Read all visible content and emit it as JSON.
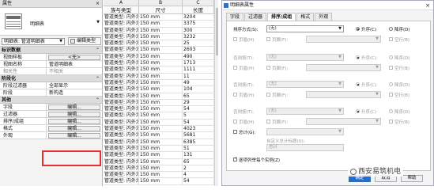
{
  "props": {
    "title": "属性",
    "close": "×",
    "type_name": "明细表",
    "selector": "明细表: 管道明细表",
    "edit_type": "编辑类型",
    "groups": [
      {
        "label": "标识数据",
        "rows": [
          {
            "k": "视图样板",
            "v": "<无>",
            "btn": true
          },
          {
            "k": "视图名称",
            "v": "管道明细表"
          },
          {
            "k": "相关性",
            "v": "不相关",
            "gray": true
          }
        ]
      },
      {
        "label": "阶段化",
        "rows": [
          {
            "k": "阶段过滤器",
            "v": "全部显示"
          },
          {
            "k": "阶段",
            "v": "新构造"
          }
        ]
      },
      {
        "label": "其他",
        "rows": [
          {
            "k": "字段",
            "v": "编辑...",
            "btn": true
          },
          {
            "k": "过滤器",
            "v": "编辑...",
            "btn": true
          },
          {
            "k": "排序/成组",
            "v": "编辑...",
            "btn": true
          },
          {
            "k": "格式",
            "v": "编辑...",
            "btn": true
          },
          {
            "k": "外观",
            "v": "编辑...",
            "btn": true
          }
        ]
      }
    ]
  },
  "schedule": {
    "letters": [
      "A",
      "B",
      "C"
    ],
    "headers": [
      "族与类型",
      "尺寸",
      "长度"
    ],
    "rows": [
      [
        "管道类型: 内外涂",
        "150 mm",
        "3204"
      ],
      [
        "管道类型: 内外涂",
        "150 mm",
        "3375"
      ],
      [
        "管道类型: 内外涂",
        "150 mm",
        "300"
      ],
      [
        "管道类型: 内外涂",
        "150 mm",
        "3232"
      ],
      [
        "管道类型: 内外涂",
        "150 mm",
        "25"
      ],
      [
        "管道类型: 内外涂",
        "150 mm",
        "2603"
      ],
      [
        "管道类型: 内外涂",
        "150 mm",
        "490"
      ],
      [
        "管道类型: 内外涂",
        "150 mm",
        "1713"
      ],
      [
        "管道类型: 内外涂",
        "150 mm",
        "1111"
      ],
      [
        "管道类型: 内外涂",
        "150 mm",
        "11"
      ],
      [
        "管道类型: 内外涂",
        "150 mm",
        "49"
      ],
      [
        "管道类型: 内外涂",
        "150 mm",
        "104"
      ],
      [
        "管道类型: 内外涂",
        "150 mm",
        "65"
      ],
      [
        "管道类型: 内外涂",
        "150 mm",
        "29"
      ],
      [
        "管道类型: 内外涂",
        "150 mm",
        "54"
      ],
      [
        "管道类型: 内外涂",
        "150 mm",
        "5"
      ],
      [
        "管道类型: 内外涂",
        "150 mm",
        "54"
      ],
      [
        "管道类型: 内外涂",
        "150 mm",
        "4023"
      ],
      [
        "管道类型: 内外涂",
        "150 mm",
        "5681"
      ],
      [
        "管道类型: 内外涂",
        "150 mm",
        "6385"
      ],
      [
        "管道类型: 内外涂",
        "150 mm",
        "51"
      ],
      [
        "管道类型: 内外涂",
        "150 mm",
        "131"
      ],
      [
        "管道类型: 内外涂",
        "150 mm",
        "65"
      ],
      [
        "管道类型: 内外涂",
        "150 mm",
        "2"
      ],
      [
        "管道类型: 内外涂",
        "150 mm",
        "4"
      ],
      [
        "管道类型: 内外涂",
        "150 mm",
        "54"
      ]
    ]
  },
  "dialog": {
    "title": "明细表属性",
    "close": "×",
    "tabs": [
      "字段",
      "过滤器",
      "排序/成组",
      "格式",
      "外观"
    ],
    "active_tab": 2,
    "sort_by": "排序方式(S):",
    "then_by": "否则按(T):",
    "none": "(无)",
    "asc": "升序(C)",
    "desc": "降序(D)",
    "header": "页眉(H)",
    "footer": "页脚(F):",
    "blank": "空行(B)",
    "grand_total": "总计(G):",
    "custom_title": "自定义总计标题(U):",
    "total_text": "总计",
    "itemize": "逐项列举每个实例(Z)",
    "ok": "确定",
    "cancel": "取消",
    "help": "帮助"
  },
  "watermark": "西安易筑机电"
}
